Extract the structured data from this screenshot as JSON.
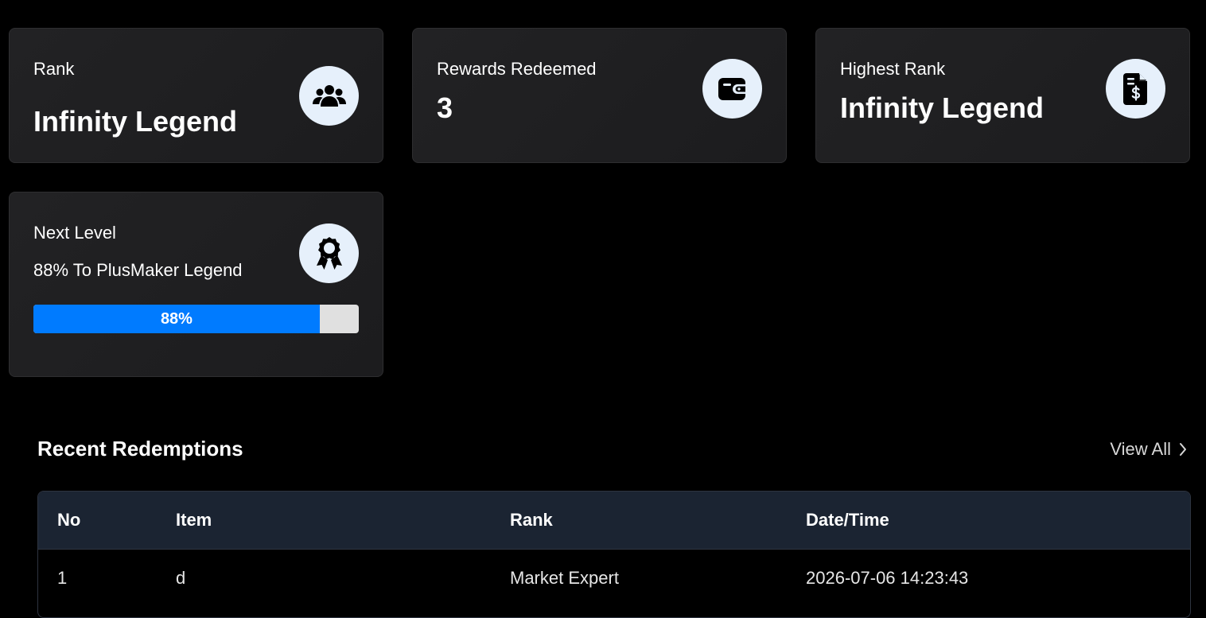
{
  "cards": {
    "rank": {
      "label": "Rank",
      "value": "Infinity Legend",
      "icon": "users-icon"
    },
    "rewards": {
      "label": "Rewards Redeemed",
      "value": "3",
      "icon": "wallet-icon"
    },
    "highest": {
      "label": "Highest Rank",
      "value": "Infinity Legend",
      "icon": "invoice-dollar-icon"
    },
    "next_level": {
      "label": "Next Level",
      "subtitle": "88% To PlusMaker Legend",
      "progress_percent": 88,
      "progress_label": "88%",
      "icon": "award-ribbon-icon"
    }
  },
  "redemptions": {
    "title": "Recent Redemptions",
    "view_all_label": "View All",
    "columns": [
      "No",
      "Item",
      "Rank",
      "Date/Time"
    ],
    "rows": [
      [
        "1",
        "d",
        "Market Expert",
        "2026-07-06 14:23:43"
      ]
    ]
  },
  "colors": {
    "background": "#000000",
    "card": "#1f1f21",
    "icon_circle": "#e6f0fb",
    "progress_fill": "#007bff",
    "progress_track": "#e0e0e0",
    "table_header": "#1b2432"
  }
}
